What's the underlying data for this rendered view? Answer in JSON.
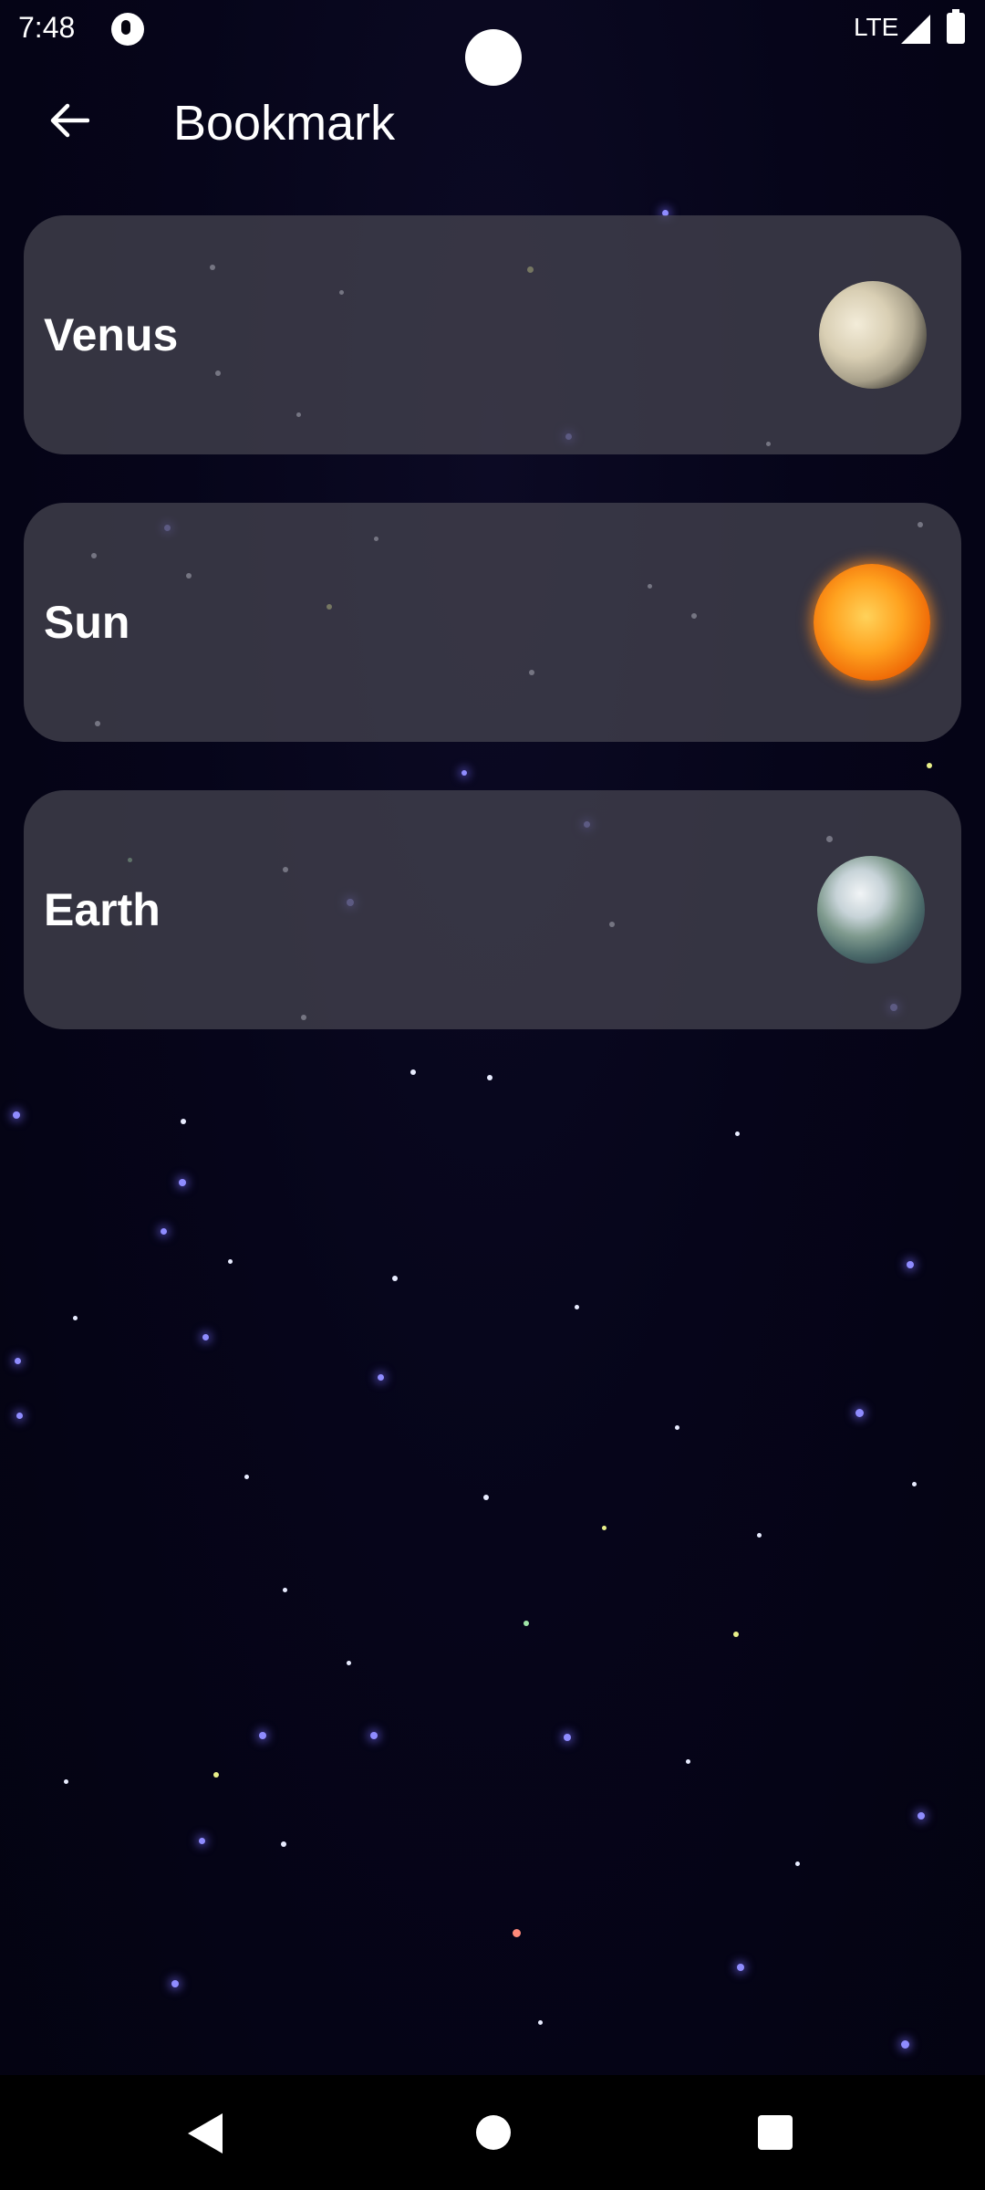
{
  "status_bar": {
    "time": "7:48",
    "network": "LTE"
  },
  "app_bar": {
    "title": "Bookmark",
    "back_icon": "arrow-left-icon"
  },
  "bookmarks": [
    {
      "label": "Venus",
      "icon": "venus-planet-image"
    },
    {
      "label": "Sun",
      "icon": "sun-image"
    },
    {
      "label": "Earth",
      "icon": "earth-planet-image"
    }
  ],
  "nav_bar": {
    "back_icon": "triangle-back-icon",
    "home_icon": "circle-home-icon",
    "recents_icon": "square-recents-icon"
  }
}
